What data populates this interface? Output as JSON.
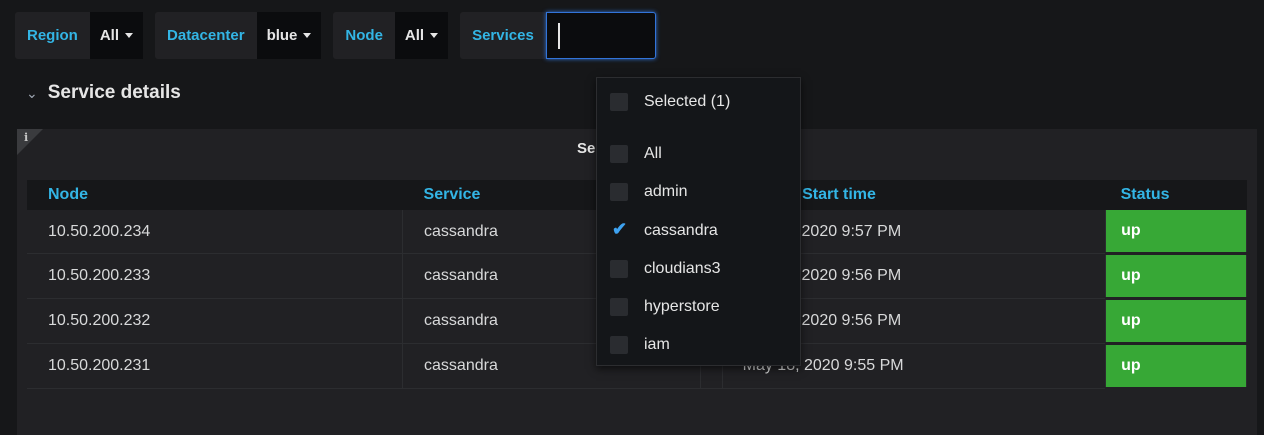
{
  "variables": [
    {
      "label": "Region",
      "value": "All"
    },
    {
      "label": "Datacenter",
      "value": "blue"
    },
    {
      "label": "Node",
      "value": "All"
    },
    {
      "label": "Services",
      "value": ""
    }
  ],
  "row": {
    "title": "Service details"
  },
  "panel": {
    "info_icon": "i",
    "title": "Se",
    "columns": [
      "Node",
      "Service",
      "",
      "Start time",
      "Status"
    ],
    "rows": [
      {
        "node": "10.50.200.234",
        "service": "cassandra",
        "start_time": ", 2020 9:57 PM",
        "status": "up"
      },
      {
        "node": "10.50.200.233",
        "service": "cassandra",
        "start_time": ", 2020 9:56 PM",
        "status": "up"
      },
      {
        "node": "10.50.200.232",
        "service": "cassandra",
        "start_time": ", 2020 9:56 PM",
        "status": "up"
      },
      {
        "node": "10.50.200.231",
        "service": "cassandra",
        "start_time": "May 18, 2020 9:55 PM",
        "status": "up"
      }
    ]
  },
  "dropdown": {
    "selected_label": "Selected (1)",
    "options": [
      {
        "label": "All",
        "checked": false
      },
      {
        "label": "admin",
        "checked": false
      },
      {
        "label": "cassandra",
        "checked": true
      },
      {
        "label": "cloudians3",
        "checked": false
      },
      {
        "label": "hyperstore",
        "checked": false
      },
      {
        "label": "iam",
        "checked": false
      }
    ]
  },
  "icons": {
    "caret": "caret-down-icon",
    "chevron": "chevron-down-icon",
    "check": "check-icon"
  },
  "colors": {
    "accent": "#33b5e5",
    "status_up": "#37a836",
    "focus": "#3274d9",
    "check": "#3ea2f0"
  }
}
